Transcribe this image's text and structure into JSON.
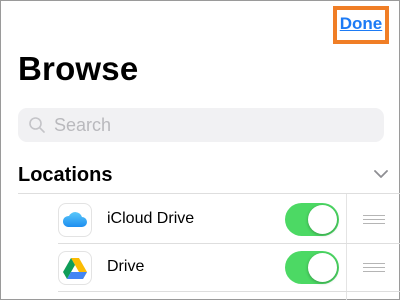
{
  "header": {
    "done_label": "Done"
  },
  "page": {
    "title": "Browse"
  },
  "search": {
    "placeholder": "Search"
  },
  "locations": {
    "title": "Locations",
    "items": [
      {
        "label": "iCloud Drive",
        "icon": "icloud-drive-icon",
        "enabled": true
      },
      {
        "label": "Drive",
        "icon": "google-drive-icon",
        "enabled": true
      }
    ]
  },
  "colors": {
    "accent": "#1d7bf5",
    "highlight_border": "#f07e26",
    "toggle_on": "#4cd964"
  }
}
